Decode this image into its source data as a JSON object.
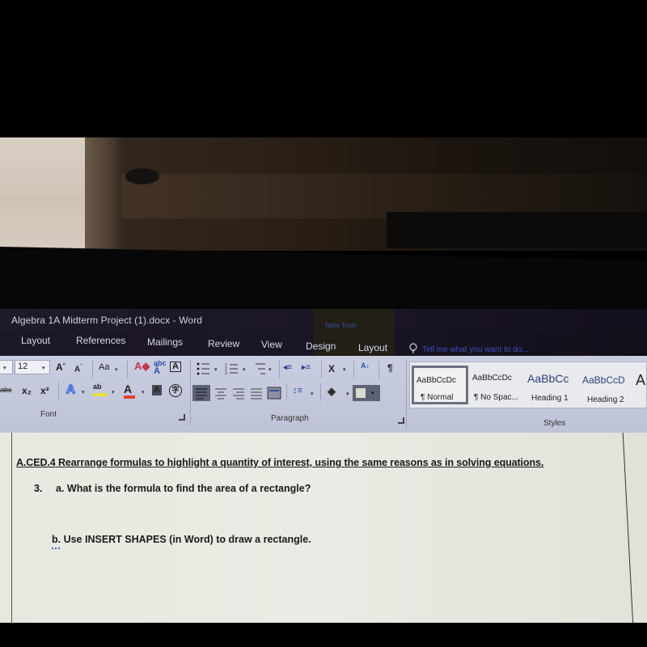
{
  "window": {
    "title": "Algebra 1A Midterm Project (1).docx - Word",
    "contextual_group": "Table Tools"
  },
  "tabs": [
    {
      "label": "Layout"
    },
    {
      "label": "References"
    },
    {
      "label": "Mailings"
    },
    {
      "label": "Review"
    },
    {
      "label": "View"
    },
    {
      "label": "Design"
    },
    {
      "label": "Layout"
    }
  ],
  "tell_me": {
    "placeholder": "Tell me what you want to do..."
  },
  "ribbon": {
    "font": {
      "label": "Font",
      "font_size": "12",
      "buttons": {
        "grow": "Aˆ",
        "shrink": "Aˇ",
        "change_case": "Aa",
        "strike": "abc",
        "subscript": "x₂",
        "superscript": "x²",
        "text_effects": "A",
        "highlight": "ab",
        "font_color": "A",
        "char_shading": "A",
        "enclose": "字",
        "phonetic": "A",
        "border": "A"
      }
    },
    "paragraph": {
      "label": "Paragraph",
      "buttons": {
        "sort": "A↓",
        "show_marks": "¶"
      }
    },
    "styles": {
      "label": "Styles",
      "items": [
        {
          "preview": "AaBbCcDc",
          "name": "¶ Normal",
          "selected": true
        },
        {
          "preview": "AaBbCcDc",
          "name": "¶ No Spac..."
        },
        {
          "preview": "AaBbCc",
          "name": "Heading 1"
        },
        {
          "preview": "AaBbCcD",
          "name": "Heading 2"
        },
        {
          "preview": "A",
          "name": ""
        }
      ]
    }
  },
  "document": {
    "standard": "A.CED.4 Rearrange formulas to highlight a quantity of interest, using the same reasons as in solving equations.",
    "question_number": "3.",
    "question_a": "a. What is the formula to find the area of a rectangle?",
    "question_b": "b. Use INSERT SHAPES (in Word) to draw a rectangle."
  },
  "colors": {
    "ribbon_bg": "#c5c9dc",
    "titlebar_bg": "#1c1727",
    "tell_me_text": "#3a4fb8",
    "doc_bg": "#e8ebe2",
    "highlight_yellow": "#e8e23a",
    "font_red": "#e0402e",
    "text_effects_blue": "#3b6fd6"
  }
}
